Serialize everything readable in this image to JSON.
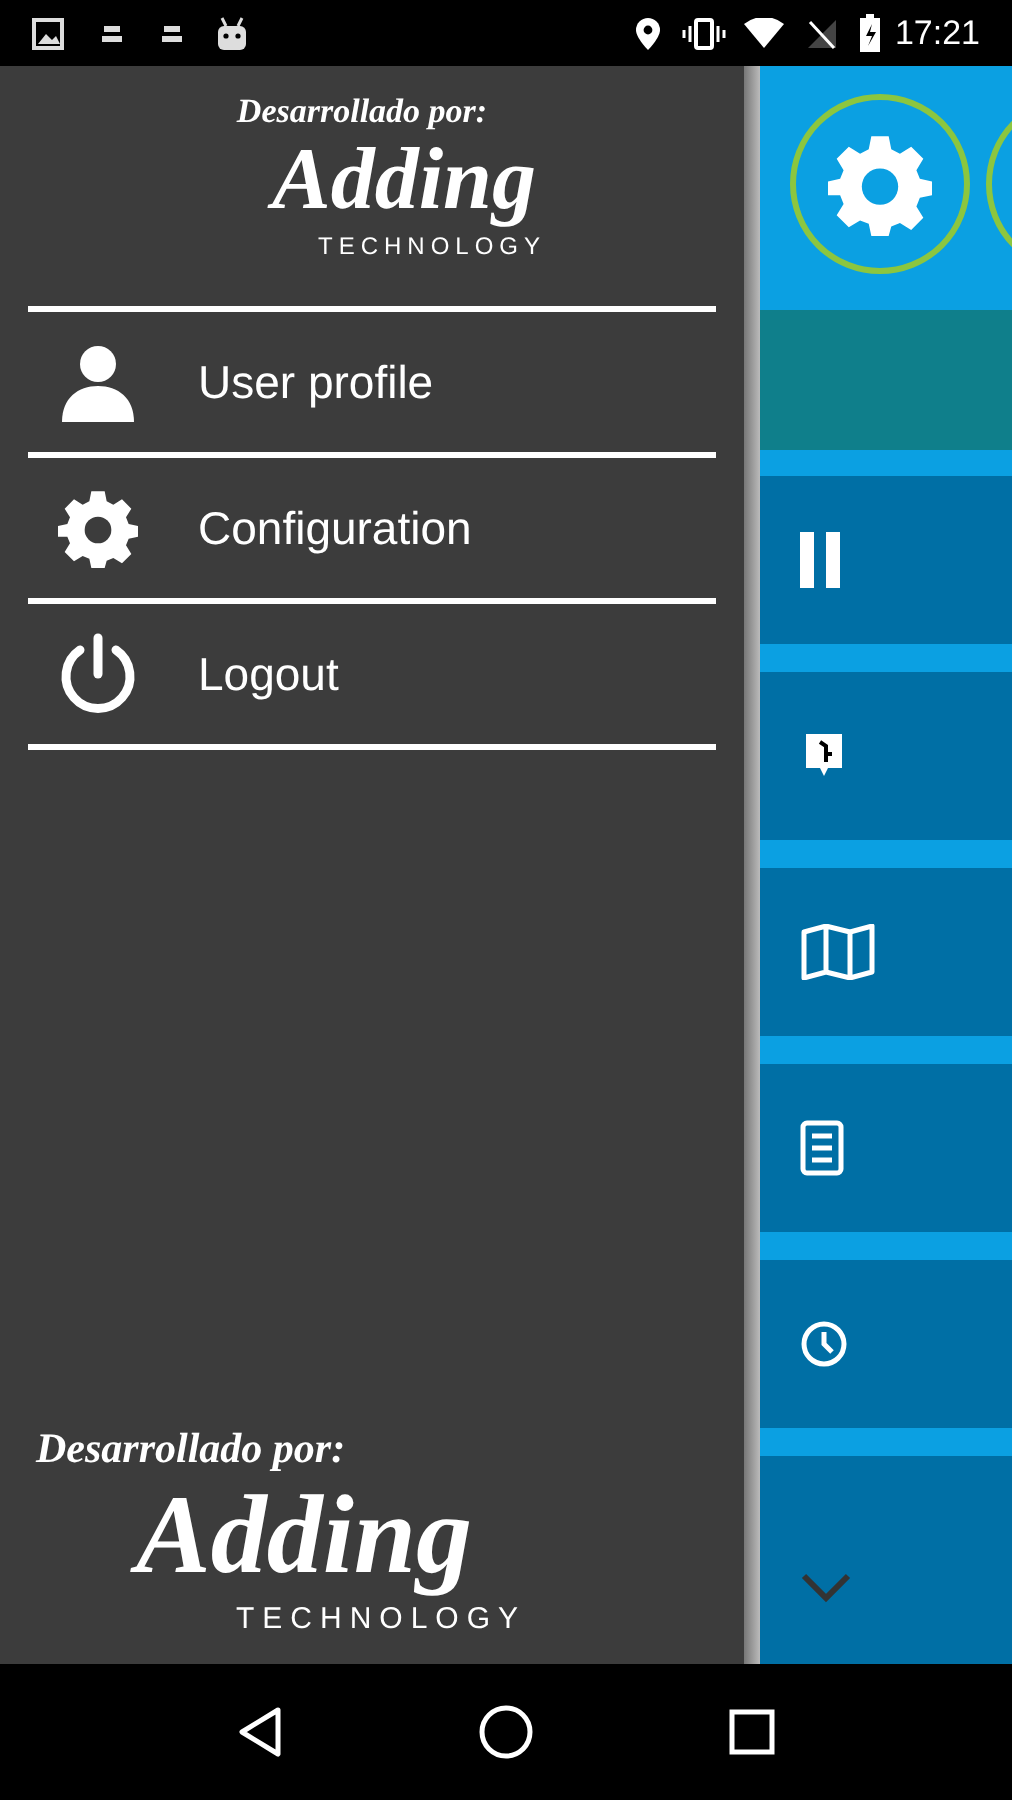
{
  "status_bar": {
    "time": "17:21"
  },
  "drawer": {
    "header_logo": {
      "tagline": "Desarrollado por:",
      "brand": "Adding",
      "subtitle": "TECHNOLOGY"
    },
    "menu": [
      {
        "label": "User profile",
        "kind": "profile"
      },
      {
        "label": "Configuration",
        "kind": "settings"
      },
      {
        "label": "Logout",
        "kind": "logout"
      }
    ],
    "footer_logo": {
      "tagline": "Desarrollado por:",
      "brand": "Adding",
      "subtitle": "TECHNOLOGY"
    }
  }
}
